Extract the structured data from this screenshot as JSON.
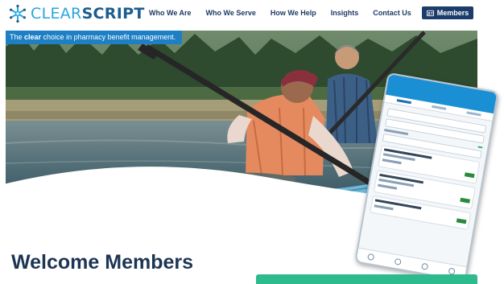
{
  "header": {
    "logo": {
      "word1": "CLEAR",
      "word2": "SCRIPT",
      "icon": "snowflake-icon"
    },
    "nav": [
      {
        "label": "Who We Are"
      },
      {
        "label": "Who We Serve"
      },
      {
        "label": "How We Help"
      },
      {
        "label": "Insights"
      },
      {
        "label": "Contact Us"
      }
    ],
    "members_button": {
      "label": "Members",
      "icon": "id-card-icon"
    }
  },
  "hero": {
    "tagline_pre": "The ",
    "tagline_bold": "clear",
    "tagline_post": " choice in pharmacy benefit management.",
    "image": "family-kayaking-photo"
  },
  "main": {
    "heading": "Welcome Members"
  },
  "colors": {
    "brand_light": "#2aa6de",
    "brand_dark": "#1b5e8e",
    "nav_text": "#1d3b63",
    "members_bg": "#1c3d6b",
    "tagline_bg": "#1e7fc4",
    "heading": "#1d3554",
    "cta_green": "#2dba8c"
  }
}
